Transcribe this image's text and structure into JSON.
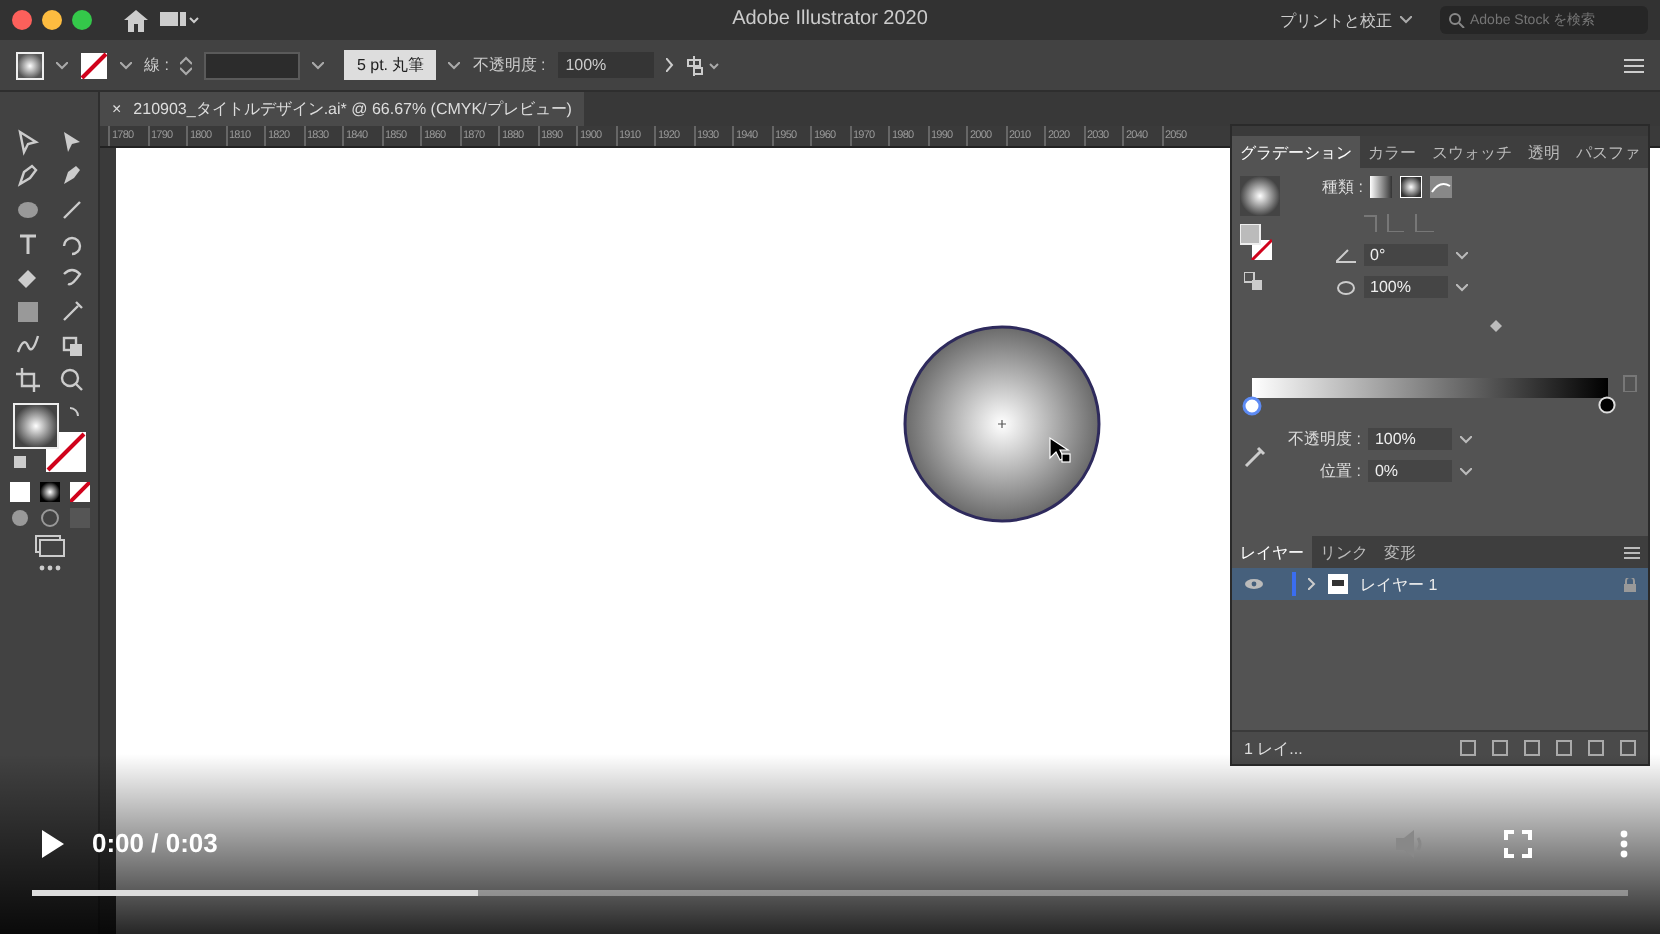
{
  "title_bar": {
    "title": "Adobe Illustrator 2020",
    "workspace": "プリントと校正",
    "search": {
      "placeholder": "Adobe Stock を検索"
    }
  },
  "control_bar": {
    "stroke_label": "線 :",
    "brush": "5 pt. 丸筆",
    "opacity_label": "不透明度 :",
    "opacity": "100%"
  },
  "document_tab": {
    "title": "210903_タイトルデザイン.ai* @ 66.67% (CMYK/プレビュー)",
    "close": "×"
  },
  "ruler": {
    "labels": [
      "1780",
      "1790",
      "1800",
      "1810",
      "1820",
      "1830",
      "1840",
      "1850",
      "1860",
      "1870",
      "1880",
      "1890",
      "1900",
      "1910",
      "1920",
      "1930",
      "1940",
      "1950",
      "1960",
      "1970",
      "1980",
      "1990",
      "2000",
      "2010",
      "2020",
      "2030",
      "2040",
      "2050"
    ]
  },
  "gradient_panel": {
    "tabs": [
      {
        "label": "グラデーション",
        "selected": true
      },
      {
        "label": "カラー",
        "selected": false
      },
      {
        "label": "スウォッチ",
        "selected": false
      },
      {
        "label": "透明",
        "selected": false
      },
      {
        "label": "パスファ",
        "selected": false
      }
    ],
    "type_label": "種類 :",
    "angle": "0°",
    "aspect": "100%",
    "opacity_label": "不透明度 :",
    "opacity": "100%",
    "location_label": "位置 :",
    "location": "0%"
  },
  "layers_panel": {
    "tabs": [
      {
        "label": "レイヤー",
        "selected": true
      },
      {
        "label": "リンク",
        "selected": false
      },
      {
        "label": "変形",
        "selected": false
      }
    ],
    "layers": [
      {
        "name": "レイヤー 1",
        "visible": true,
        "selected": true
      }
    ],
    "footer": "1 レイ..."
  },
  "player": {
    "time": "0:00 / 0:03",
    "progress": {
      "level": 0.28
    }
  }
}
